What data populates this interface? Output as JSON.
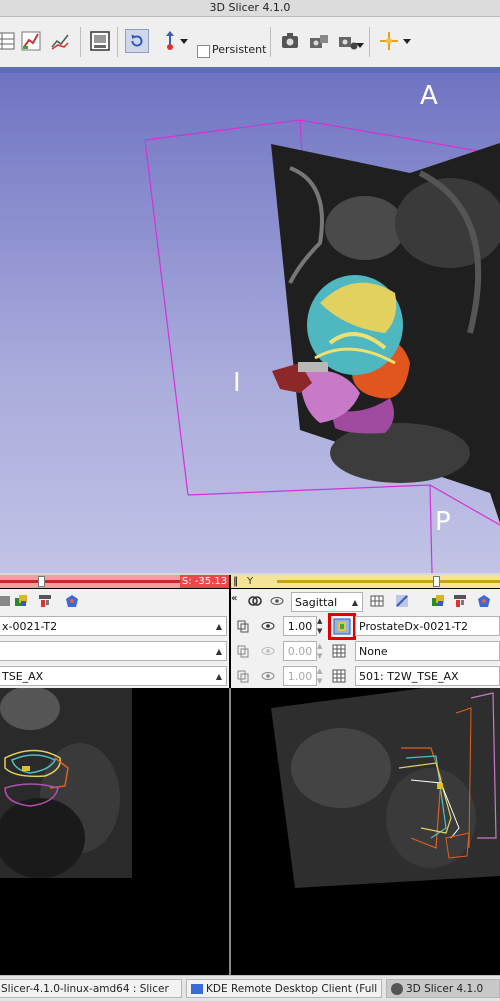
{
  "window": {
    "title": "3D Slicer 4.1.0"
  },
  "toolbar": {
    "persistent_label": "Persistent"
  },
  "view3d": {
    "orientation": {
      "anterior": "A",
      "inferior": "I",
      "posterior": "P"
    }
  },
  "red_slice": {
    "offset_label": "S: -35.13",
    "offset_fraction": 0.55,
    "node_name": "x-0021-T2",
    "label_volume": "TSE_AX"
  },
  "yellow_slice": {
    "letter": "Y",
    "offset_fraction": 0.7,
    "orientation": "Sagittal",
    "foreground_opacity": "1.00",
    "foreground_volume": "ProstateDx-0021-T2",
    "label_opacity": "0.00",
    "label_volume": "None",
    "background_opacity": "1.00",
    "background_volume": "501: T2W_TSE_AX"
  },
  "taskbar": {
    "items": [
      {
        "label": "Slicer-4.1.0-linux-amd64 : Slicer"
      },
      {
        "label": "KDE Remote Desktop Client (Full Scre"
      },
      {
        "label": "3D Slicer 4.1.0"
      }
    ]
  },
  "colors": {
    "red_slider": "#e84a4a",
    "yellow_slider": "#f0c830",
    "highlight": "#ff0000",
    "bbox": "#d432d4"
  }
}
